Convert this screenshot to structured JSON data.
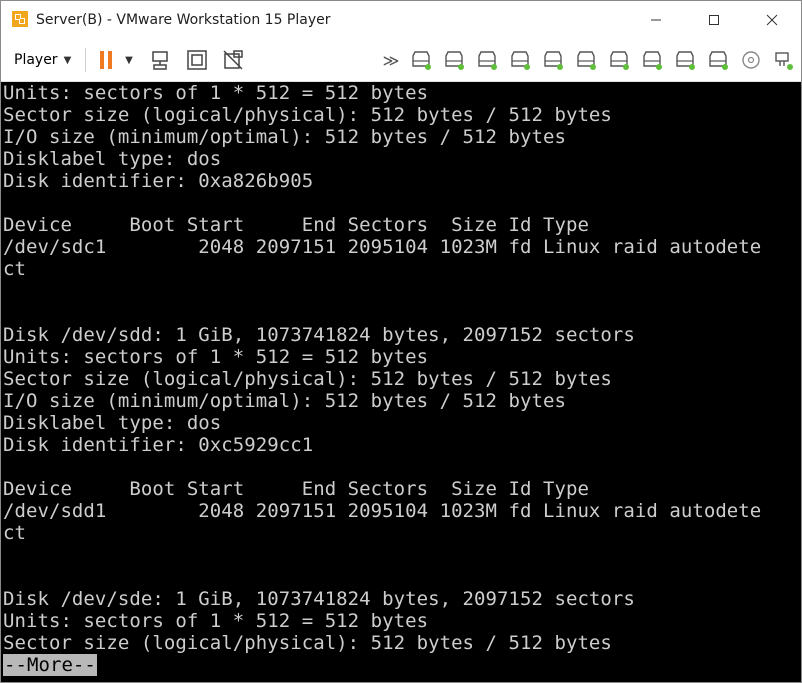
{
  "window": {
    "title": "Server(B) - VMware Workstation 15 Player"
  },
  "toolbar": {
    "player_label": "Player",
    "icons": [
      "pause-icon",
      "send-ctrl-alt-del-icon",
      "fit-guest-icon",
      "unity-icon",
      "more-devices-icon",
      "hdd-icon",
      "cd-icon",
      "usb-icon"
    ]
  },
  "terminal": {
    "lines": [
      "Units: sectors of 1 * 512 = 512 bytes",
      "Sector size (logical/physical): 512 bytes / 512 bytes",
      "I/O size (minimum/optimal): 512 bytes / 512 bytes",
      "Disklabel type: dos",
      "Disk identifier: 0xa826b905",
      "",
      "Device     Boot Start     End Sectors  Size Id Type",
      "/dev/sdc1        2048 2097151 2095104 1023M fd Linux raid autodete",
      "ct",
      "",
      "",
      "Disk /dev/sdd: 1 GiB, 1073741824 bytes, 2097152 sectors",
      "Units: sectors of 1 * 512 = 512 bytes",
      "Sector size (logical/physical): 512 bytes / 512 bytes",
      "I/O size (minimum/optimal): 512 bytes / 512 bytes",
      "Disklabel type: dos",
      "Disk identifier: 0xc5929cc1",
      "",
      "Device     Boot Start     End Sectors  Size Id Type",
      "/dev/sdd1        2048 2097151 2095104 1023M fd Linux raid autodete",
      "ct",
      "",
      "",
      "Disk /dev/sde: 1 GiB, 1073741824 bytes, 2097152 sectors",
      "Units: sectors of 1 * 512 = 512 bytes",
      "Sector size (logical/physical): 512 bytes / 512 bytes"
    ],
    "more_prompt": "--More--"
  },
  "colors": {
    "terminal_bg": "#000000",
    "terminal_fg": "#cdcdcd",
    "accent_orange": "#f07a22",
    "device_green": "#5fbf3a"
  }
}
